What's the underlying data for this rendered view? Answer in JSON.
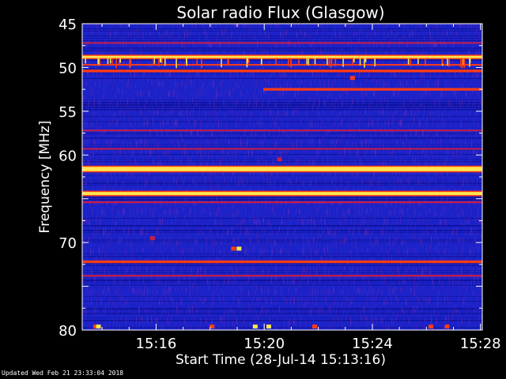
{
  "footer": {
    "updated": "Updated Wed Feb 21 23:33:04 2018"
  },
  "colors": {
    "background": "#000000",
    "text": "#ffffff",
    "plot_base": "#1a22c8",
    "low": "#0a0f96",
    "mid": "#c81e46",
    "high": "#ff3c14",
    "peak": "#ffe650"
  },
  "chart_data": {
    "type": "heatmap",
    "title": "Solar radio Flux (Glasgow)",
    "xlabel": "Start Time (28-Jul-14 15:13:16)",
    "ylabel": "Frequency [MHz]",
    "x_ticks": [
      "15:16",
      "15:20",
      "15:24",
      "15:28"
    ],
    "x_tick_minutes": [
      2.733,
      6.733,
      10.733,
      14.733
    ],
    "y_ticks": [
      45,
      50,
      55,
      60,
      65,
      70,
      75,
      80
    ],
    "y_tick_labels": [
      "45",
      "50",
      "55",
      "60",
      "",
      "70",
      "",
      "80"
    ],
    "ylim": [
      45,
      80
    ],
    "xlim_minutes": [
      0,
      14.8
    ],
    "bands": [
      {
        "freq": 48.8,
        "width": 0.25,
        "level": "peak",
        "start_min": 0,
        "end_min": 14.8
      },
      {
        "freq": 49.7,
        "width": 0.15,
        "level": "high",
        "start_min": 0,
        "end_min": 14.8
      },
      {
        "freq": 50.4,
        "width": 0.3,
        "level": "high",
        "start_min": 0,
        "end_min": 14.8
      },
      {
        "freq": 52.5,
        "width": 0.3,
        "level": "high",
        "start_min": 6.7,
        "end_min": 14.8
      },
      {
        "freq": 61.6,
        "width": 0.5,
        "level": "peak",
        "start_min": 0,
        "end_min": 14.8
      },
      {
        "freq": 64.4,
        "width": 0.35,
        "level": "peak",
        "start_min": 0,
        "end_min": 14.8
      },
      {
        "freq": 72.2,
        "width": 0.3,
        "level": "high",
        "start_min": 0,
        "end_min": 14.8
      },
      {
        "freq": 73.8,
        "width": 0.2,
        "level": "mid",
        "start_min": 0,
        "end_min": 14.8
      },
      {
        "freq": 59.3,
        "width": 0.15,
        "level": "mid",
        "start_min": 0,
        "end_min": 14.8
      },
      {
        "freq": 65.4,
        "width": 0.2,
        "level": "mid",
        "start_min": 0,
        "end_min": 14.8
      },
      {
        "freq": 47.2,
        "width": 0.12,
        "level": "mid",
        "start_min": 0,
        "end_min": 14.8
      },
      {
        "freq": 57.2,
        "width": 0.12,
        "level": "mid",
        "start_min": 0,
        "end_min": 14.8
      }
    ],
    "spots": [
      {
        "t_min": 5.8,
        "freq": 70.7,
        "level": "peak"
      },
      {
        "t_min": 5.6,
        "freq": 70.7,
        "level": "high"
      },
      {
        "t_min": 0.5,
        "freq": 79.6,
        "level": "high"
      },
      {
        "t_min": 0.6,
        "freq": 79.6,
        "level": "peak"
      },
      {
        "t_min": 4.8,
        "freq": 79.6,
        "level": "high"
      },
      {
        "t_min": 6.4,
        "freq": 79.6,
        "level": "peak"
      },
      {
        "t_min": 6.9,
        "freq": 79.6,
        "level": "peak"
      },
      {
        "t_min": 8.6,
        "freq": 79.6,
        "level": "high"
      },
      {
        "t_min": 12.9,
        "freq": 79.6,
        "level": "high"
      },
      {
        "t_min": 13.5,
        "freq": 79.6,
        "level": "high"
      },
      {
        "t_min": 10.0,
        "freq": 51.2,
        "level": "high"
      },
      {
        "t_min": 7.3,
        "freq": 60.5,
        "level": "mid"
      },
      {
        "t_min": 2.6,
        "freq": 69.5,
        "level": "mid"
      }
    ]
  }
}
